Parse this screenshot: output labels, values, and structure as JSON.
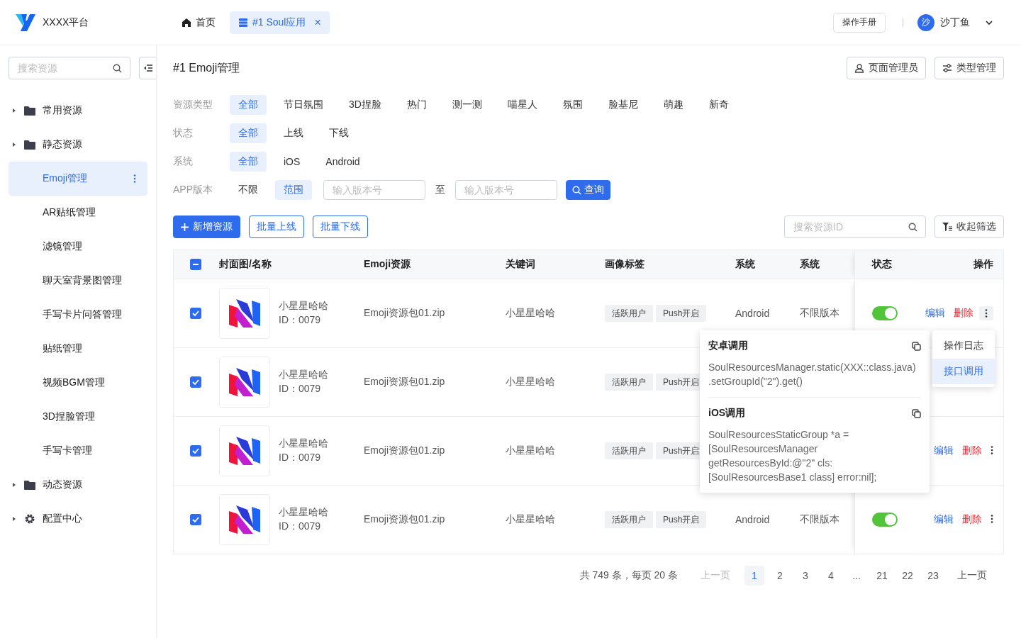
{
  "header": {
    "logo_text": "XXXX平台",
    "tabs": [
      {
        "label": "首页",
        "kind": "home",
        "selected": false,
        "closable": false
      },
      {
        "label": "#1 Soul应用",
        "kind": "app",
        "selected": true,
        "closable": true
      }
    ],
    "close_glyph": "×",
    "manual_button": "操作手册",
    "user": {
      "avatar_text": "沙",
      "name": "沙丁鱼"
    }
  },
  "sidebar": {
    "search_placeholder": "搜索资源",
    "items": [
      {
        "label": "常用资源",
        "kind": "folder",
        "selected": false
      },
      {
        "label": "静态资源",
        "kind": "folder",
        "selected": false,
        "children": [
          {
            "label": "Emoji管理",
            "selected": true
          },
          {
            "label": "AR贴纸管理",
            "selected": false
          },
          {
            "label": "滤镜管理",
            "selected": false
          },
          {
            "label": "聊天室背景图管理",
            "selected": false
          },
          {
            "label": "手写卡片问答管理",
            "selected": false
          },
          {
            "label": "贴纸管理",
            "selected": false
          },
          {
            "label": "视频BGM管理",
            "selected": false
          },
          {
            "label": "3D捏脸管理",
            "selected": false
          },
          {
            "label": "手写卡管理",
            "selected": false
          }
        ]
      },
      {
        "label": "动态资源",
        "kind": "folder",
        "selected": false
      },
      {
        "label": "配置中心",
        "kind": "settings",
        "selected": false
      }
    ]
  },
  "page": {
    "title": "#1 Emoji管理",
    "buttons": [
      {
        "label": "页面管理员",
        "kind": "admin"
      },
      {
        "label": "类型管理",
        "kind": "types"
      }
    ]
  },
  "filters": [
    {
      "label": "资源类型",
      "options": [
        {
          "label": "全部",
          "selected": true
        },
        {
          "label": "节日氛围",
          "selected": false
        },
        {
          "label": "3D捏脸",
          "selected": false
        },
        {
          "label": "热门",
          "selected": false
        },
        {
          "label": "测一测",
          "selected": false
        },
        {
          "label": "喵星人",
          "selected": false
        },
        {
          "label": "氛围",
          "selected": false
        },
        {
          "label": "脸基尼",
          "selected": false
        },
        {
          "label": "萌趣",
          "selected": false
        },
        {
          "label": "新奇",
          "selected": false
        }
      ]
    },
    {
      "label": "状态",
      "options": [
        {
          "label": "全部",
          "selected": true
        },
        {
          "label": "上线",
          "selected": false
        },
        {
          "label": "下线",
          "selected": false
        }
      ]
    },
    {
      "label": "系统",
      "options": [
        {
          "label": "全部",
          "selected": true
        },
        {
          "label": "iOS",
          "selected": false
        },
        {
          "label": "Android",
          "selected": false
        }
      ]
    },
    {
      "label": "APP版本",
      "options": [
        {
          "label": "不限",
          "selected": false
        },
        {
          "label": "范围",
          "selected": true
        }
      ],
      "range": {
        "from_placeholder": "输入版本号",
        "separator": "至",
        "to_placeholder": "输入版本号",
        "button": "查询"
      }
    }
  ],
  "toolbar": {
    "add_button": "新增资源",
    "batch_buttons": [
      "批量上线",
      "批量下线"
    ],
    "id_search_placeholder": "搜索资源ID",
    "collapse_button": "收起筛选"
  },
  "table": {
    "header_partial": true,
    "columns": [
      "封面图/名称",
      "Emoji资源",
      "关键词",
      "画像标签",
      "系统",
      "系统",
      "状态",
      "操作"
    ],
    "rows": [
      {
        "checked": true,
        "name": "小星星哈哈",
        "id": "ID：0079",
        "resource": "Emoji资源包01.zip",
        "keyword": "小星星哈哈",
        "tags": [
          "活跃用户",
          "Push开启"
        ],
        "system": "Android",
        "version": "不限版本",
        "status_on": true,
        "actions": {
          "edit": "编辑",
          "delete": "删除"
        }
      },
      {
        "checked": true,
        "name": "小星星哈哈",
        "id": "ID：0079",
        "resource": "Emoji资源包01.zip",
        "keyword": "小星星哈哈",
        "tags": [
          "活跃用户",
          "Push开启"
        ]
      },
      {
        "checked": true,
        "name": "小星星哈哈",
        "id": "ID：0079",
        "resource": "Emoji资源包01.zip",
        "keyword": "小星星哈哈",
        "tags": [
          "活跃用户",
          "Push开启"
        ],
        "actions": {
          "edit": "编辑",
          "delete": "删除"
        }
      },
      {
        "checked": true,
        "name": "小星星哈哈",
        "id": "ID：0079",
        "resource": "Emoji资源包01.zip",
        "keyword": "小星星哈哈",
        "tags": [
          "活跃用户",
          "Push开启"
        ],
        "system": "Android",
        "version": "不限版本",
        "status_on": true,
        "actions": {
          "edit": "编辑",
          "delete": "删除"
        }
      }
    ]
  },
  "popover": {
    "sections": [
      {
        "title": "安卓调用",
        "code": "SoulResourcesManager.static(XXX::class.java)\n.setGroupId(\"2\").get()"
      },
      {
        "title": "iOS调用",
        "code": "SoulResourcesStaticGroup *a =\n[SoulResourcesManager\ngetResourcesById:@\"2\" cls:\n[SoulResourcesBase1 class] error:nil];"
      }
    ],
    "menu": [
      {
        "label": "操作日志",
        "selected": false
      },
      {
        "label": "接口调用",
        "selected": true
      }
    ]
  },
  "pagination": {
    "summary": "共 749 条，每页 20 条",
    "prev": "上一页",
    "prev_disabled": true,
    "pages": [
      {
        "label": "1",
        "selected": true
      },
      {
        "label": "2",
        "selected": false
      },
      {
        "label": "3",
        "selected": false
      },
      {
        "label": "4",
        "selected": false
      },
      {
        "label": "...",
        "selected": false
      },
      {
        "label": "21",
        "selected": false
      },
      {
        "label": "22",
        "selected": false
      },
      {
        "label": "23",
        "selected": false
      }
    ],
    "next": "上一页"
  }
}
